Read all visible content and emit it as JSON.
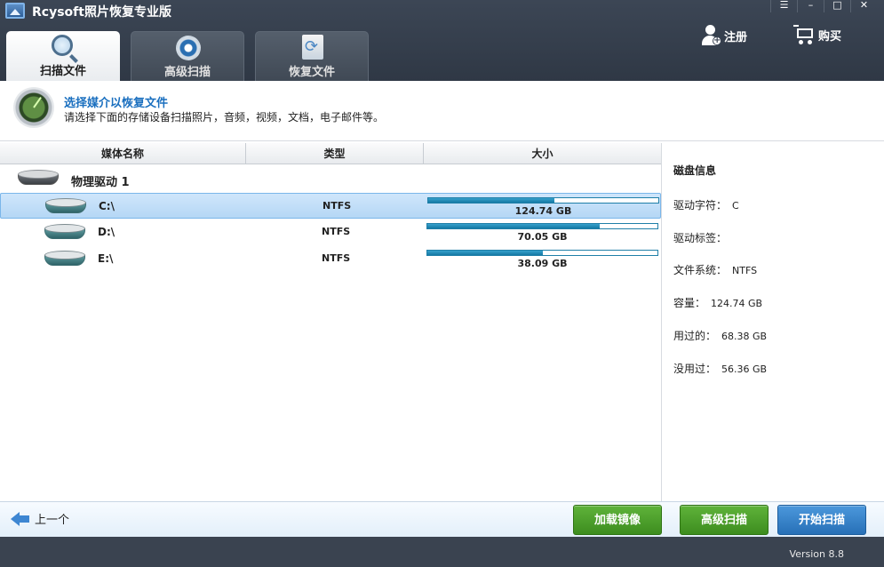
{
  "window": {
    "title": "Rcysoft照片恢复专业版",
    "controls": [
      "☰",
      "–",
      "□",
      "✕"
    ]
  },
  "header": {
    "register_label": "注册",
    "buy_label": "购买"
  },
  "tabs": [
    {
      "label": "扫描文件",
      "active": true
    },
    {
      "label": "高级扫描",
      "active": false
    },
    {
      "label": "恢复文件",
      "active": false
    }
  ],
  "banner": {
    "title": "选择媒介以恢复文件",
    "description": "请选择下面的存储设备扫描照片，音频，视频，文档，电子邮件等。"
  },
  "table": {
    "columns": [
      "媒体名称",
      "类型",
      "大小"
    ],
    "physical_drive": "物理驱动 1",
    "drives": [
      {
        "letter": "C:\\",
        "fs": "NTFS",
        "size": "124.74 GB",
        "fill": 0.55,
        "selected": true
      },
      {
        "letter": "D:\\",
        "fs": "NTFS",
        "size": "70.05 GB",
        "fill": 0.75,
        "selected": false
      },
      {
        "letter": "E:\\",
        "fs": "NTFS",
        "size": "38.09 GB",
        "fill": 0.5,
        "selected": false
      }
    ]
  },
  "disk_info": {
    "title": "磁盘信息",
    "rows": [
      {
        "label": "驱动字符：",
        "value": "C"
      },
      {
        "label": "驱动标签：",
        "value": ""
      },
      {
        "label": "文件系统：",
        "value": "NTFS"
      },
      {
        "label": "容量：",
        "value": "124.74 GB"
      },
      {
        "label": "用过的：",
        "value": "68.38 GB"
      },
      {
        "label": "没用过：",
        "value": "56.36 GB"
      }
    ]
  },
  "bottom": {
    "back_label": "上一个",
    "load_image_label": "加载镜像",
    "advanced_scan_label": "高级扫描",
    "start_scan_label": "开始扫描"
  },
  "footer": {
    "version": "Version 8.8"
  },
  "colors": {
    "header_bg": "#3c4655",
    "accent_blue": "#1a6fbf",
    "button_green": "#4ea02c",
    "button_blue": "#3a84c9",
    "bar_fill": "#1f8ab8"
  }
}
